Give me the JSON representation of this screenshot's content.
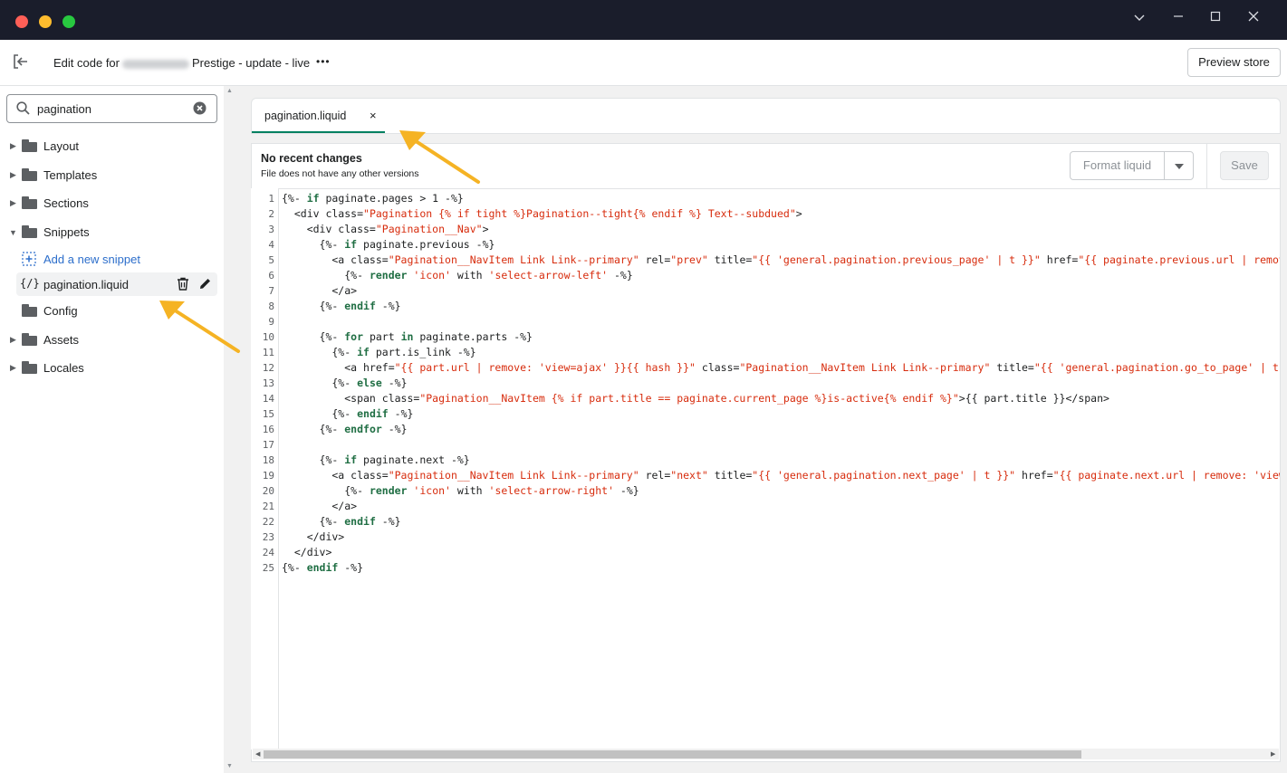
{
  "window": {
    "controls": [
      "chevron-down-icon",
      "minimize-icon",
      "maximize-icon",
      "close-icon"
    ],
    "traffic_colors": [
      "#ff5f57",
      "#febc2e",
      "#28c840"
    ]
  },
  "header": {
    "title_prefix": "Edit code for",
    "title_suffix": "Prestige - update - live",
    "more_label": "•••",
    "preview_label": "Preview store"
  },
  "sidebar": {
    "search": {
      "value": "pagination"
    },
    "items": [
      {
        "label": "Layout",
        "expanded": false
      },
      {
        "label": "Templates",
        "expanded": false
      },
      {
        "label": "Sections",
        "expanded": false
      },
      {
        "label": "Snippets",
        "expanded": true
      },
      {
        "label": "Config",
        "expanded": false
      },
      {
        "label": "Assets",
        "expanded": false
      },
      {
        "label": "Locales",
        "expanded": false
      }
    ],
    "add_snippet_label": "Add a new snippet",
    "file": {
      "icon_text": "{/}",
      "name": "pagination.liquid"
    }
  },
  "editor": {
    "tab_label": "pagination.liquid",
    "tab_close": "×",
    "status_title": "No recent changes",
    "status_subtitle": "File does not have any other versions",
    "format_label": "Format liquid",
    "save_label": "Save",
    "code_lines": [
      "{%- if paginate.pages > 1 -%}",
      "  <div class=\"Pagination {% if tight %}Pagination--tight{% endif %} Text--subdued\">",
      "    <div class=\"Pagination__Nav\">",
      "      {%- if paginate.previous -%}",
      "        <a class=\"Pagination__NavItem Link Link--primary\" rel=\"prev\" title=\"{{ 'general.pagination.previous_page' | t }}\" href=\"{{ paginate.previous.url | remove: 'view=ajax' }}\">",
      "          {%- render 'icon' with 'select-arrow-left' -%}",
      "        </a>",
      "      {%- endif -%}",
      "",
      "      {%- for part in paginate.parts -%}",
      "        {%- if part.is_link -%}",
      "          <a href=\"{{ part.url | remove: 'view=ajax' }}{{ hash }}\" class=\"Pagination__NavItem Link Link--primary\" title=\"{{ 'general.pagination.go_to_page' | t: page: part.title }}\">{{ part.title }}</a>",
      "        {%- else -%}",
      "          <span class=\"Pagination__NavItem {% if part.title == paginate.current_page %}is-active{% endif %}\">{{ part.title }}</span>",
      "        {%- endif -%}",
      "      {%- endfor -%}",
      "",
      "      {%- if paginate.next -%}",
      "        <a class=\"Pagination__NavItem Link Link--primary\" rel=\"next\" title=\"{{ 'general.pagination.next_page' | t }}\" href=\"{{ paginate.next.url | remove: 'view=ajax' }}\">",
      "          {%- render 'icon' with 'select-arrow-right' -%}",
      "        </a>",
      "      {%- endif -%}",
      "    </div>",
      "  </div>",
      "{%- endif -%}"
    ]
  },
  "colors": {
    "titlebar": "#1a1d2b",
    "accent_arrow": "#f5b324",
    "tab_underline": "#008060",
    "link": "#2c6ecb",
    "string": "#d72c0d",
    "keyword": "#1f6e43",
    "attr": "#7a3a8a"
  }
}
